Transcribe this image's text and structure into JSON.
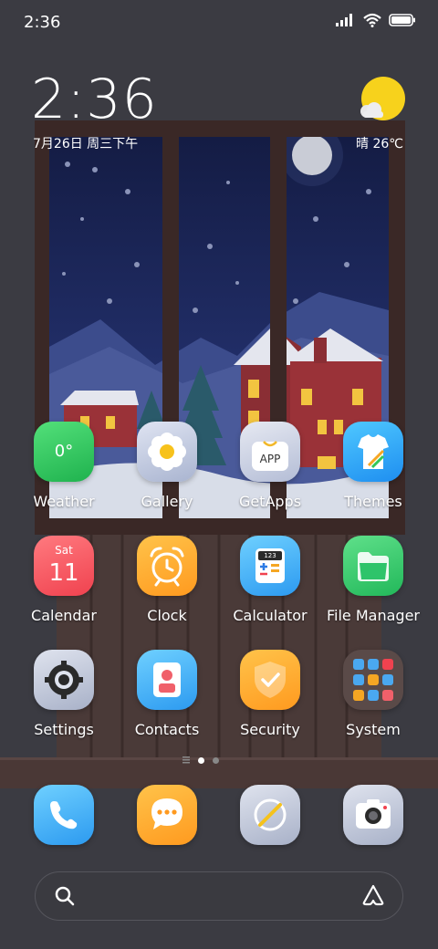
{
  "status_bar": {
    "time": "2:36"
  },
  "clock_widget": {
    "time": "2:36",
    "date": "7月26日 周三下午",
    "weather": "晴 26℃"
  },
  "apps_row1": [
    {
      "label": "Weather",
      "icon": "weather-icon",
      "badge_text": "0°"
    },
    {
      "label": "Gallery",
      "icon": "gallery-icon"
    },
    {
      "label": "GetApps",
      "icon": "getapps-icon",
      "badge_text": "APP"
    },
    {
      "label": "Themes",
      "icon": "themes-icon"
    }
  ],
  "apps_row2": [
    {
      "label": "Calendar",
      "icon": "calendar-icon",
      "day": "Sat",
      "date": "11"
    },
    {
      "label": "Clock",
      "icon": "clock-icon"
    },
    {
      "label": "Calculator",
      "icon": "calculator-icon",
      "display": "123"
    },
    {
      "label": "File Manager",
      "icon": "folder-icon"
    }
  ],
  "apps_row3": [
    {
      "label": "Settings",
      "icon": "gear-icon"
    },
    {
      "label": "Contacts",
      "icon": "contacts-icon"
    },
    {
      "label": "Security",
      "icon": "shield-icon"
    },
    {
      "label": "System",
      "icon": "folder-grid-icon"
    }
  ],
  "dock": [
    {
      "icon": "phone-icon"
    },
    {
      "icon": "messages-icon"
    },
    {
      "icon": "browser-icon"
    },
    {
      "icon": "camera-icon"
    }
  ],
  "search": {
    "left_icon": "search-icon",
    "right_icon": "assistant-icon"
  },
  "page_indicator": {
    "pages": 2,
    "current": 1
  }
}
